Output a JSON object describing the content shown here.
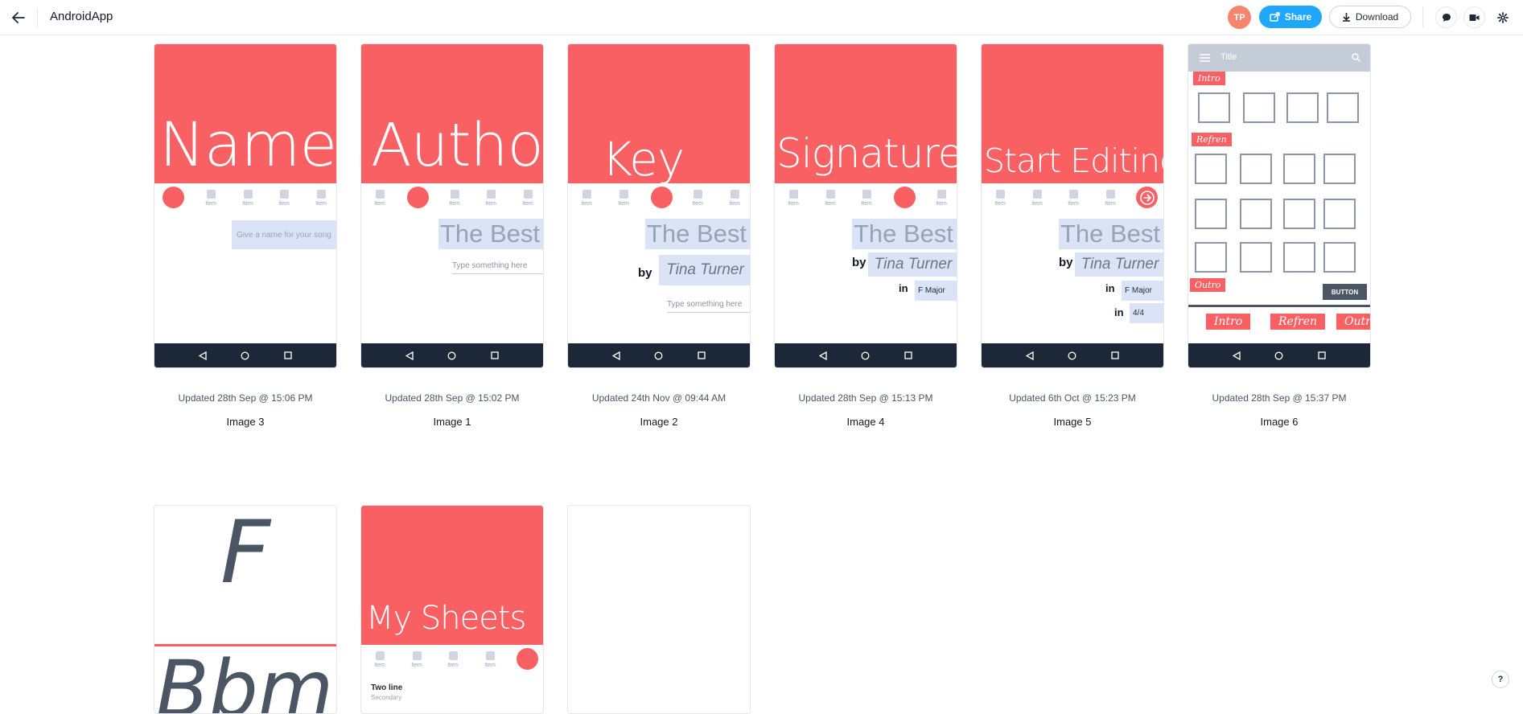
{
  "header": {
    "title": "AndroidApp",
    "avatar_initials": "TP",
    "share_label": "Share",
    "download_label": "Download",
    "accent": "#1ea7fd"
  },
  "colors": {
    "hero": "#f96063",
    "navbar": "#1c2838",
    "field": "#dbe4f7"
  },
  "cards": [
    {
      "name": "Image 3",
      "updated": "Updated 28th Sep @ 15:06 PM",
      "hero": "Name",
      "field": "Give a name for your song"
    },
    {
      "name": "Image 1",
      "updated": "Updated 28th Sep @ 15:02 PM",
      "hero": "Author",
      "title_field": "The Best",
      "placeholder": "Type something here"
    },
    {
      "name": "Image 2",
      "updated": "Updated 24th Nov @ 09:44 AM",
      "hero": "Key",
      "title_field": "The Best",
      "by": "by",
      "artist": "Tina Turner",
      "placeholder": "Type something here"
    },
    {
      "name": "Image 4",
      "updated": "Updated 28th Sep @ 15:13 PM",
      "hero": "Signature",
      "title_field": "The Best",
      "by": "by",
      "artist": "Tina Turner",
      "in": "in",
      "key": "F Major"
    },
    {
      "name": "Image 5",
      "updated": "Updated 6th Oct @ 15:23 PM",
      "hero": "Start Editing",
      "title_field": "The Best",
      "by": "by",
      "artist": "Tina Turner",
      "in": "in",
      "key": "F Major",
      "in2": "in",
      "signature": "4/4"
    },
    {
      "name": "Image 6",
      "updated": "Updated 28th Sep @ 15:37 PM",
      "appbar_title": "Title",
      "intro": "Intro",
      "refren": "Refren",
      "outro": "Outro",
      "button": "BUTTON",
      "tabs": [
        "Intro",
        "Refren",
        "Outro"
      ]
    }
  ],
  "tab_item_label": "Item",
  "row2": [
    {
      "hero_top": "F",
      "hero_bottom": "Bbm"
    },
    {
      "hero": "My Sheets",
      "list_primary": "Two line",
      "list_secondary": "Secondary"
    },
    {}
  ],
  "help_label": "?"
}
